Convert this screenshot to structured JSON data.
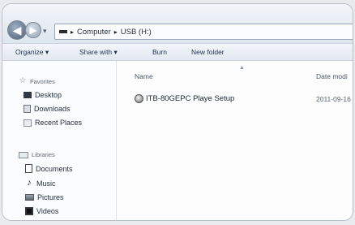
{
  "address": {
    "segments": [
      "Computer",
      "USB (H:)"
    ]
  },
  "toolbar": {
    "organize": "Organize ▾",
    "share": "Share with ▾",
    "burn": "Burn",
    "new_folder": "New folder"
  },
  "sidebar": {
    "favorites_header": "Favorites",
    "favorites": [
      {
        "label": "Desktop",
        "icon": "desktop-icon"
      },
      {
        "label": "Downloads",
        "icon": "downloads-icon"
      },
      {
        "label": "Recent Places",
        "icon": "recent-places-icon"
      }
    ],
    "libraries_header": "Libraries",
    "libraries": [
      {
        "label": "Documents",
        "icon": "documents-icon"
      },
      {
        "label": "Music",
        "icon": "music-icon"
      },
      {
        "label": "Pictures",
        "icon": "pictures-icon"
      },
      {
        "label": "Videos",
        "icon": "videos-icon"
      }
    ]
  },
  "columns": {
    "name": "Name",
    "date": "Date modi"
  },
  "files": [
    {
      "name": "ITB-80GEPC Playe Setup",
      "date": "2011-09-16",
      "icon": "setup-icon"
    }
  ]
}
